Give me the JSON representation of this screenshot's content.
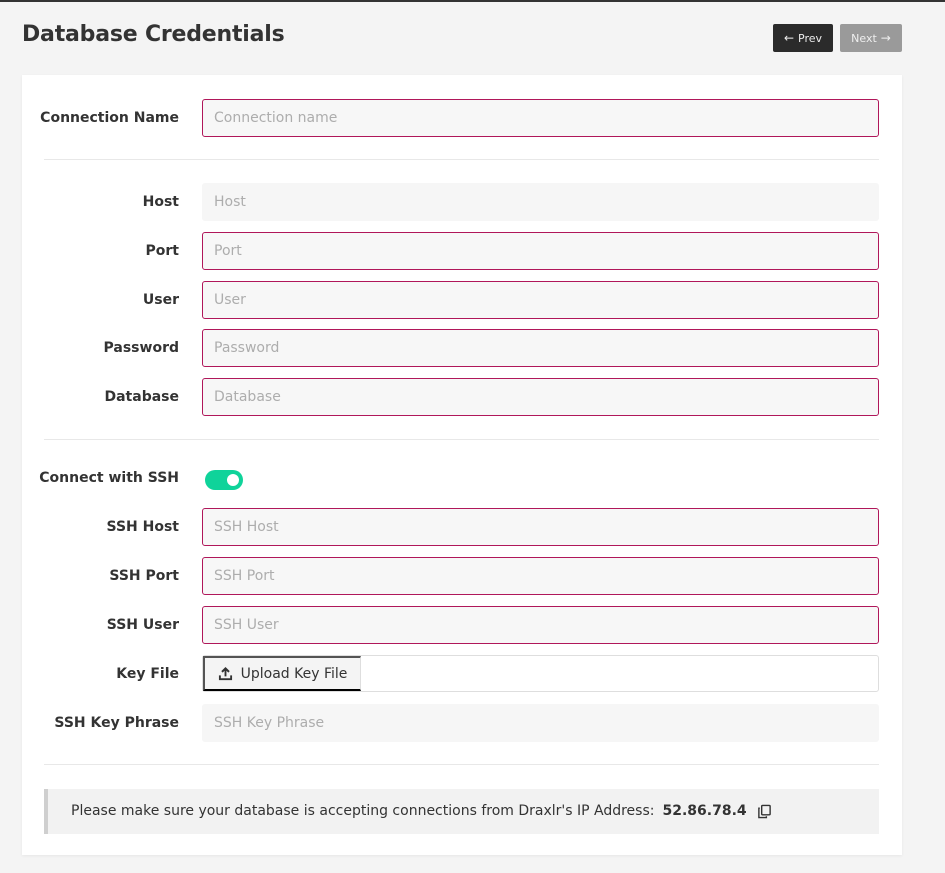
{
  "header": {
    "title": "Database Credentials",
    "prev_label": "Prev",
    "next_label": "Next"
  },
  "form": {
    "connection_name": {
      "label": "Connection Name",
      "value": "",
      "placeholder": "Connection name"
    },
    "host": {
      "label": "Host",
      "value": "",
      "placeholder": "Host"
    },
    "port": {
      "label": "Port",
      "value": "",
      "placeholder": "Port"
    },
    "user": {
      "label": "User",
      "value": "",
      "placeholder": "User"
    },
    "password": {
      "label": "Password",
      "value": "",
      "placeholder": "Password"
    },
    "database": {
      "label": "Database",
      "value": "",
      "placeholder": "Database"
    },
    "connect_ssh": {
      "label": "Connect with SSH",
      "enabled": true
    },
    "ssh_host": {
      "label": "SSH Host",
      "value": "",
      "placeholder": "SSH Host"
    },
    "ssh_port": {
      "label": "SSH Port",
      "value": "",
      "placeholder": "SSH Port"
    },
    "ssh_user": {
      "label": "SSH User",
      "value": "",
      "placeholder": "SSH User"
    },
    "key_file": {
      "label": "Key File",
      "button_label": "Upload Key File",
      "filename": ""
    },
    "ssh_key_phrase": {
      "label": "SSH Key Phrase",
      "value": "",
      "placeholder": "SSH Key Phrase"
    }
  },
  "notice": {
    "text": "Please make sure your database is accepting connections from Draxlr's IP Address:",
    "ip": "52.86.78.4"
  },
  "colors": {
    "invalid_border": "#b0175a",
    "toggle_on": "#0fd39a",
    "prev_button_bg": "#2b2b2b",
    "next_button_bg": "#9a9a9a"
  },
  "icons": {
    "prev": "arrow-left-icon",
    "next": "arrow-right-icon",
    "upload": "upload-icon",
    "copy": "copy-icon"
  }
}
